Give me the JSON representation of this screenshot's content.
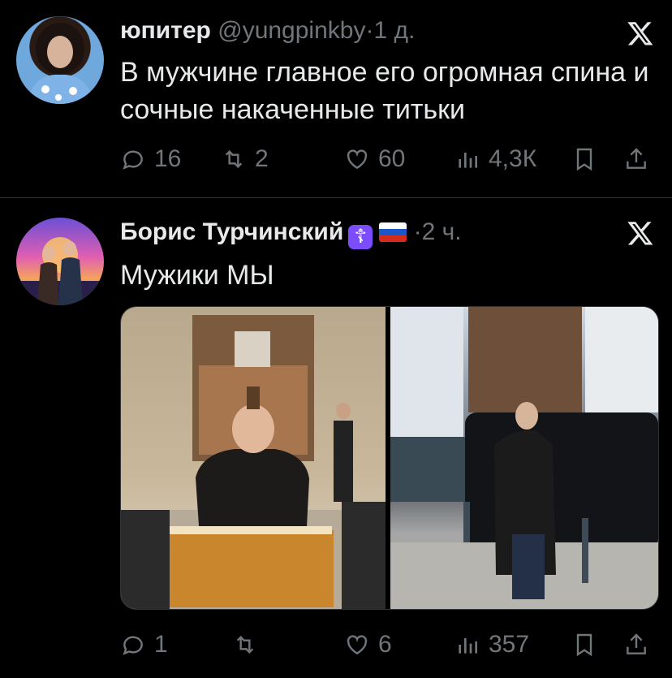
{
  "tweets": [
    {
      "name": "юпитер",
      "handle": "@yungpinkby",
      "separator": "·",
      "time": "1 д.",
      "text": "В мужчине главное его огромная спина и сочные накаченные титьки",
      "stats": {
        "replies": "16",
        "retweets": "2",
        "likes": "60",
        "views": "4,3К"
      }
    },
    {
      "name": "Борис Турчинский",
      "badge": "☦",
      "separator": "·",
      "time": "2 ч.",
      "text": "Мужики МЫ",
      "stats": {
        "replies": "1",
        "retweets": "",
        "likes": "6",
        "views": "357"
      }
    }
  ],
  "colors": {
    "background": "#000000",
    "text": "#e7e9ea",
    "muted": "#71767b",
    "divider": "#2f3336",
    "badge": "#7c4dff"
  },
  "icons": [
    "x-logo-icon",
    "reply-icon",
    "retweet-icon",
    "like-icon",
    "views-icon",
    "bookmark-icon",
    "share-icon"
  ]
}
